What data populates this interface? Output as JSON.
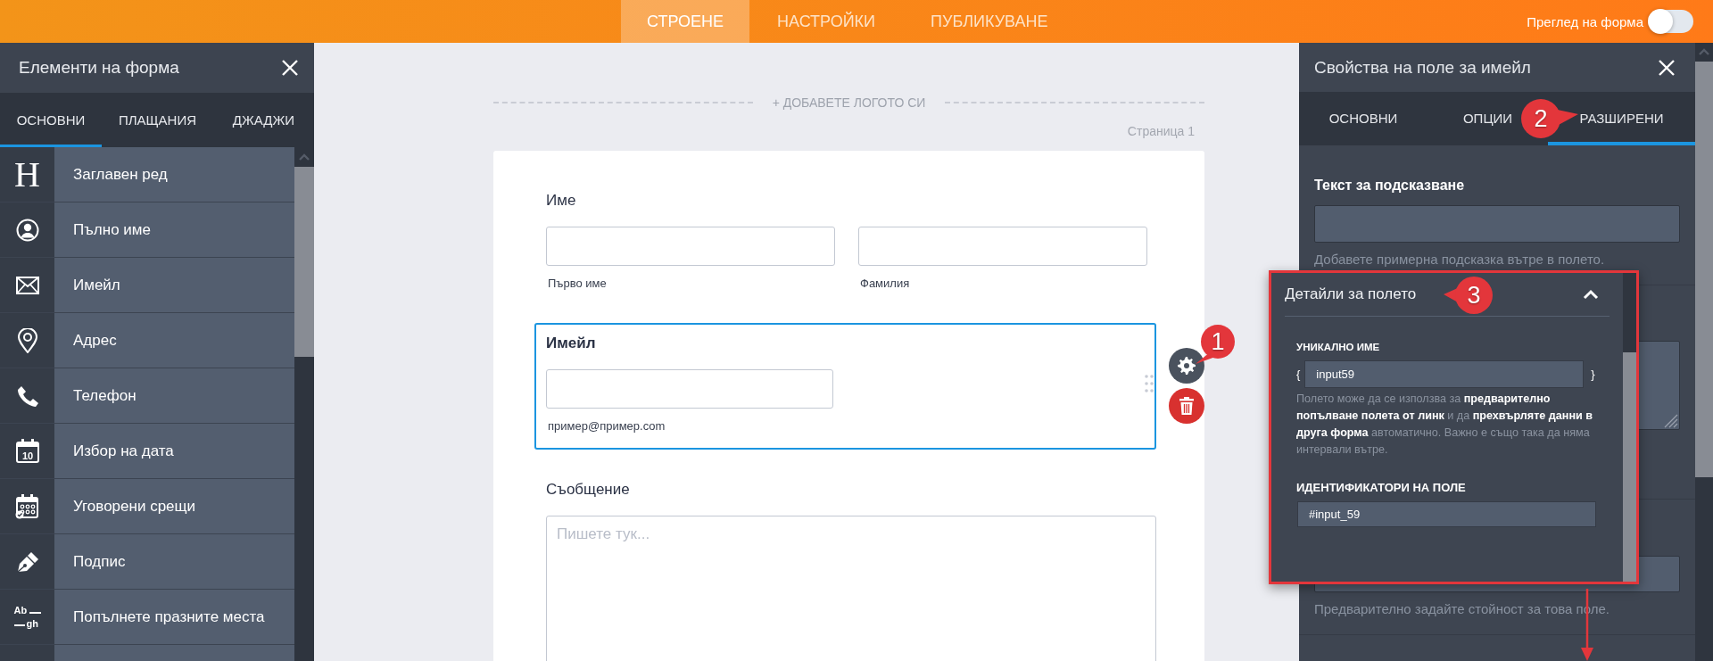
{
  "top_bar": {
    "tabs": [
      {
        "label": "СТРОЕНЕ",
        "selected": true
      },
      {
        "label": "НАСТРОЙКИ",
        "selected": false
      },
      {
        "label": "ПУБЛИКУВАНЕ",
        "selected": false
      }
    ],
    "preview_toggle": {
      "label": "Преглед на форма",
      "on": false
    }
  },
  "elements_panel": {
    "title": "Елементи на форма",
    "tabs": [
      {
        "label": "ОСНОВНИ",
        "selected": true
      },
      {
        "label": "ПЛАЩАНИЯ",
        "selected": false
      },
      {
        "label": "ДЖАДЖИ",
        "selected": false
      }
    ],
    "items": [
      {
        "kind": "heading",
        "icon_text": "H",
        "label": "Заглавен ред"
      },
      {
        "kind": "fullname",
        "label": "Пълно име"
      },
      {
        "kind": "email",
        "label": "Имейл"
      },
      {
        "kind": "address",
        "label": "Адрес"
      },
      {
        "kind": "phone",
        "label": "Телефон"
      },
      {
        "kind": "date",
        "icon_text": "10",
        "label": "Избор на дата"
      },
      {
        "kind": "appointment",
        "label": "Уговорени срещи"
      },
      {
        "kind": "signature",
        "label": "Подпис"
      },
      {
        "kind": "fill_blank",
        "icon_text": [
          "Ab",
          "gh"
        ],
        "label": "Попълнете празните места"
      }
    ]
  },
  "canvas": {
    "add_logo": "+ ДОБАВЕТЕ ЛОГОТО СИ",
    "page_label": "Страница 1",
    "fields": [
      {
        "kind": "fullname",
        "label": "Име",
        "sublabels": [
          "Първо име",
          "Фамилия"
        ],
        "selected": false
      },
      {
        "kind": "email",
        "label": "Имейл",
        "sublabel": "пример@пример.com",
        "selected": true
      },
      {
        "kind": "textarea",
        "label": "Съобщение",
        "placeholder": "Пишете тук...",
        "selected": false
      }
    ]
  },
  "properties_panel": {
    "title": "Свойства на поле за имейл",
    "tabs": [
      {
        "label": "ОСНОВНИ",
        "selected": false
      },
      {
        "label": "ОПЦИИ",
        "selected": false
      },
      {
        "label": "РАЗШИРЕНИ",
        "selected": true
      }
    ],
    "hint_label": "Текст за подсказване",
    "hint_help": "Добавете примерна подсказка вътре в полето.",
    "default_help": "Предварително задайте стойност за това поле."
  },
  "details_popup": {
    "title": "Детайли за полето",
    "expanded": true,
    "unique_name": {
      "label": "УНИКАЛНО ИМЕ",
      "open_brace": "{",
      "value": "input59",
      "close_brace": "}"
    },
    "help": "Полето може да се използва за **предварително попълване полета от линк** и да **прехвърляте данни в друга форма** автоматично. Важно е също така да няма интервали вътре.",
    "identifiers": {
      "label": "ИДЕНТИФИКАТОРИ НА ПОЛЕ",
      "value": "#input_59"
    }
  },
  "annotations": [
    {
      "number": "1"
    },
    {
      "number": "2"
    },
    {
      "number": "3"
    }
  ]
}
